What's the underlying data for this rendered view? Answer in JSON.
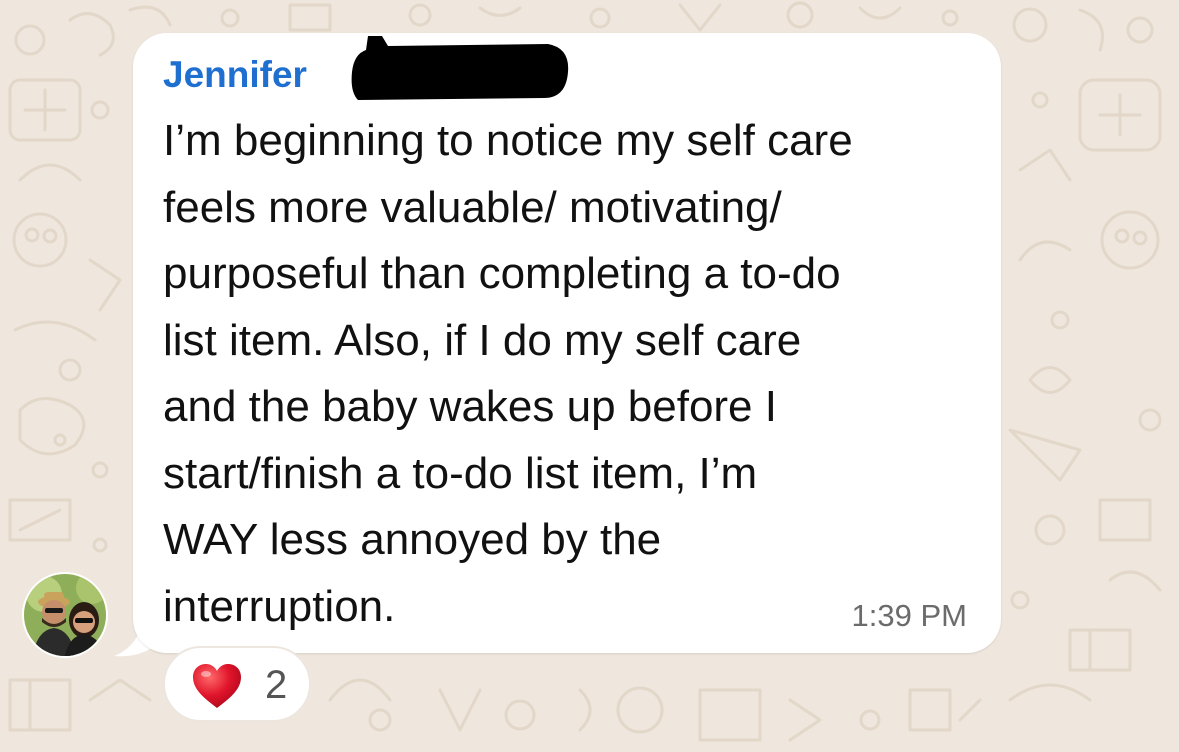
{
  "message": {
    "sender_name": "Jennifer",
    "text": "I’m beginning to notice my self care\nfeels more valuable/ motivating/\npurposeful than completing a to-do\nlist item. Also, if I do my self care\nand the baby wakes up before I\nstart/finish a to-do list item, I’m\nWAY less annoyed by the\ninterruption.",
    "time": "1:39 PM",
    "reaction": {
      "icon": "heart-icon",
      "count": "2"
    }
  },
  "colors": {
    "wallpaper": "#efe7dd",
    "sender_name": "#1f6fd1",
    "bubble": "#ffffff",
    "heart": "#e0142b"
  },
  "icons": {
    "avatar": "avatar",
    "redaction": "redaction-mark"
  }
}
